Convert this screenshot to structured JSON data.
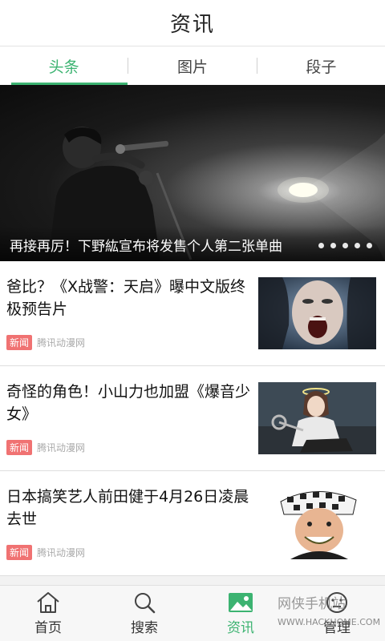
{
  "header": {
    "title": "资讯"
  },
  "tabs": [
    {
      "label": "头条",
      "active": true
    },
    {
      "label": "图片",
      "active": false
    },
    {
      "label": "段子",
      "active": false
    }
  ],
  "banner": {
    "title": "再接再厉！下野紘宣布将发售个人第二张单曲",
    "dots_count": 5
  },
  "news": [
    {
      "title": "爸比？《X战警：天启》曝中文版终极预告片",
      "tag": "新闻",
      "source": "腾讯动漫网",
      "thumb_icon": "screaming-woman-image"
    },
    {
      "title": "奇怪的角色！小山力也加盟《爆音少女》",
      "tag": "新闻",
      "source": "腾讯动漫网",
      "thumb_icon": "anime-character-image"
    },
    {
      "title": "日本搞笑艺人前田健于4月26日凌晨去世",
      "tag": "新闻",
      "source": "腾讯动漫网",
      "thumb_icon": "comedian-portrait-image"
    }
  ],
  "bottom_nav": [
    {
      "label": "首页",
      "icon": "home-icon",
      "active": false
    },
    {
      "label": "搜索",
      "icon": "search-icon",
      "active": false
    },
    {
      "label": "资讯",
      "icon": "image-icon",
      "active": true
    },
    {
      "label": "管理",
      "icon": "face-icon",
      "active": false
    }
  ],
  "watermark": {
    "text": "网侠手机站",
    "url": "WWW.HACKHOME.COM"
  },
  "colors": {
    "accent": "#3cb371",
    "tag": "#f07272"
  }
}
